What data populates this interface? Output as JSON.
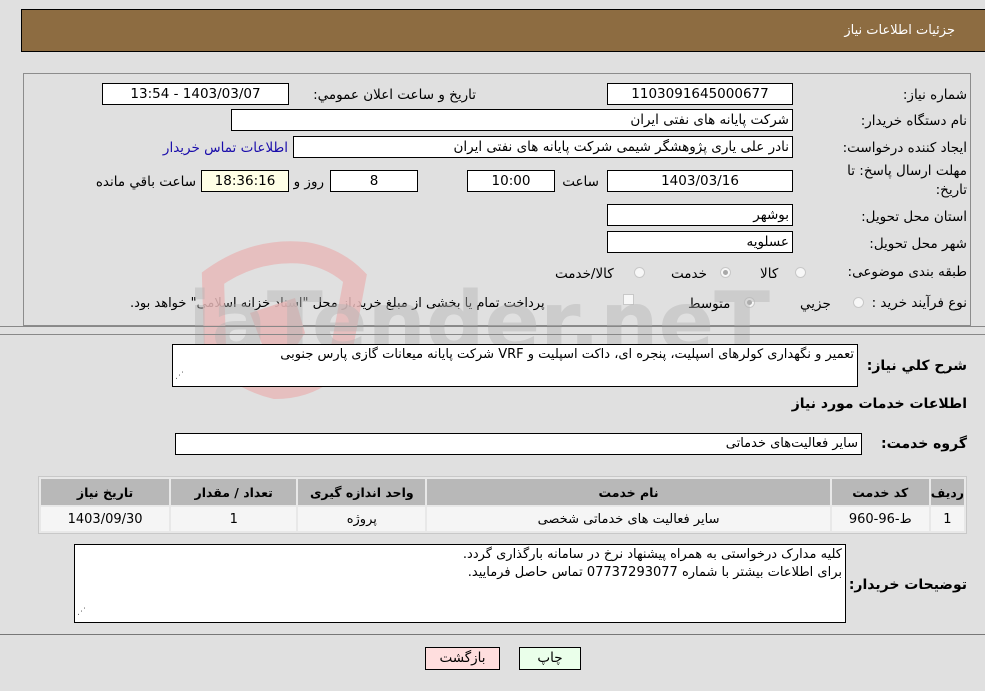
{
  "header": {
    "title": "جزئیات اطلاعات نیاز"
  },
  "form": {
    "need_number": {
      "label": "شماره نیاز:",
      "value": "1103091645000677"
    },
    "announce": {
      "label": "تاریخ و ساعت اعلان عمومي:",
      "value": "1403/03/07 - 13:54"
    },
    "buyer_org": {
      "label": "نام دستگاه خریدار:",
      "value": "شرکت پایانه های نفتی ایران"
    },
    "creator": {
      "label": "ایجاد کننده درخواست:",
      "value": "نادر علی یاری پژوهشگر شیمی شرکت پایانه های نفتی ایران",
      "contact_link": "اطلاعات تماس خریدار"
    },
    "deadline": {
      "label_line1": "مهلت ارسال پاسخ: تا",
      "label_line2": "تاریخ:",
      "date": "1403/03/16",
      "time_label": "ساعت",
      "time": "10:00",
      "days": "8",
      "days_label": "روز و",
      "remaining": "18:36:16",
      "remaining_label": "ساعت باقي مانده"
    },
    "province": {
      "label": "استان محل تحویل:",
      "value": "بوشهر"
    },
    "city": {
      "label": "شهر محل تحویل:",
      "value": "عسلویه"
    },
    "category": {
      "label": "طبقه بندی موضوعی:",
      "options": [
        {
          "label": "کالا",
          "selected": false
        },
        {
          "label": "خدمت",
          "selected": true
        },
        {
          "label": "کالا/خدمت",
          "selected": false
        }
      ]
    },
    "process": {
      "label": "نوع فرآیند خرید :",
      "options": [
        {
          "label": "جزيي",
          "selected": false
        },
        {
          "label": "متوسط",
          "selected": true
        }
      ],
      "treasury_checkbox": {
        "checked": false,
        "label": "پرداخت تمام یا بخشی از مبلغ خرید،از محل \"اسناد خزانه اسلامی\" خواهد بود."
      }
    }
  },
  "description": {
    "label": "شرح کلي نیاز:",
    "value": "تعمیر و نگهداری کولرهای اسپلیت، پنجره ای، داکت اسپلیت و VRF  شرکت پایانه میعانات گازی پارس جنوبی"
  },
  "services": {
    "section_title": "اطلاعات خدمات مورد نیاز",
    "group_label": "گروه خدمت:",
    "group_value": "سایر فعالیت‌های خدماتی",
    "table": {
      "headers": [
        "ردیف",
        "کد خدمت",
        "نام خدمت",
        "واحد اندازه گیری",
        "تعداد / مقدار",
        "تاریخ نیاز"
      ],
      "rows": [
        [
          "1",
          "ط-96-960",
          "سایر فعالیت های خدماتی شخصی",
          "پروژه",
          "1",
          "1403/09/30"
        ]
      ]
    }
  },
  "buyer_notes": {
    "label": "توضیحات خریدار:",
    "line1": "کلیه مدارک درخواستی به همراه پیشنهاد نرخ در سامانه بارگذاری گردد.",
    "line2": "برای اطلاعات بیشتر با شماره 07737293077 تماس حاصل فرمایید."
  },
  "buttons": {
    "print": "چاپ",
    "back": "بازگشت"
  },
  "watermark": {
    "text": "AriaTender.neT"
  },
  "colors": {
    "header_bg": "#8d6c41",
    "print_bg": "#eaffea",
    "back_bg": "#ffdede"
  }
}
